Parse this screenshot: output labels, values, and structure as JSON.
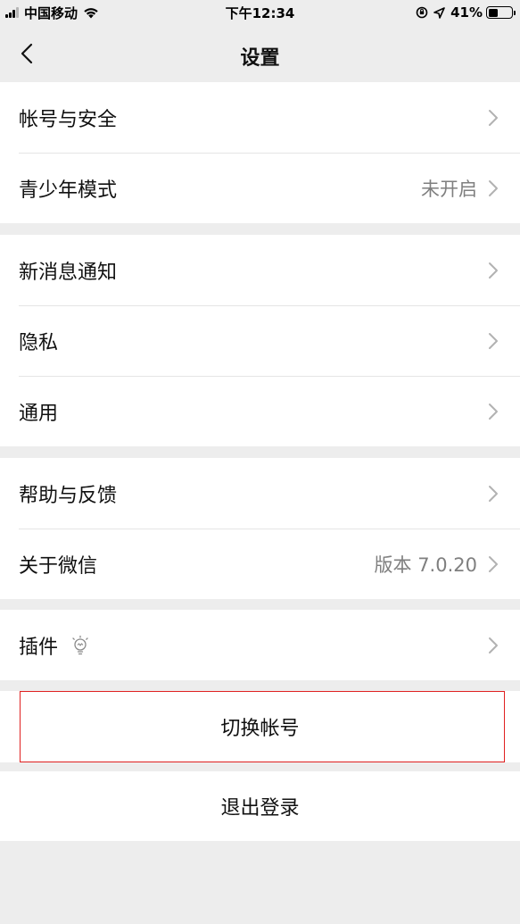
{
  "status_bar": {
    "carrier": "中国移动",
    "time": "下午12:34",
    "battery": "41%",
    "battery_level": 0.41
  },
  "nav": {
    "title": "设置"
  },
  "groups": [
    {
      "items": [
        {
          "label": "帐号与安全",
          "value": ""
        },
        {
          "label": "青少年模式",
          "value": "未开启"
        }
      ]
    },
    {
      "items": [
        {
          "label": "新消息通知",
          "value": ""
        },
        {
          "label": "隐私",
          "value": ""
        },
        {
          "label": "通用",
          "value": ""
        }
      ]
    },
    {
      "items": [
        {
          "label": "帮助与反馈",
          "value": ""
        },
        {
          "label": "关于微信",
          "value": "版本 7.0.20"
        }
      ]
    },
    {
      "items": [
        {
          "label": "插件",
          "value": "",
          "icon": "lightbulb-icon"
        }
      ]
    }
  ],
  "actions": {
    "switch_account": "切换帐号",
    "logout": "退出登录"
  }
}
